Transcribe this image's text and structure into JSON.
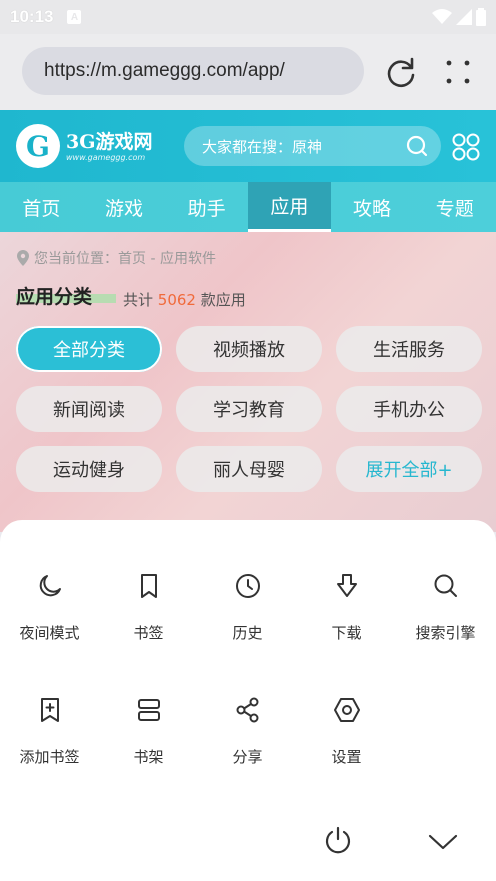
{
  "status": {
    "time": "10:13",
    "badge": "A"
  },
  "browser": {
    "url": "https://m.gameggg.com/app/"
  },
  "site": {
    "logo_text": "3G游戏网",
    "logo_sub": "www.gameggg.com",
    "search_placeholder": "大家都在搜：原神",
    "tabs": [
      "首页",
      "游戏",
      "助手",
      "应用",
      "攻略",
      "专题"
    ],
    "active_tab": "应用"
  },
  "content": {
    "breadcrumb": "您当前位置：首页 - 应用软件",
    "category_title": "应用分类",
    "count_prefix": "共计",
    "count_value": "5062",
    "count_suffix": "款应用",
    "chips": [
      "全部分类",
      "视频播放",
      "生活服务",
      "新闻阅读",
      "学习教育",
      "手机办公",
      "运动健身",
      "丽人母婴",
      "展开全部+"
    ]
  },
  "menu": {
    "items": [
      {
        "label": "夜间模式",
        "icon": "moon-icon"
      },
      {
        "label": "书签",
        "icon": "bookmark-icon"
      },
      {
        "label": "历史",
        "icon": "clock-icon"
      },
      {
        "label": "下载",
        "icon": "download-icon"
      },
      {
        "label": "搜索引擎",
        "icon": "search-icon"
      },
      {
        "label": "添加书签",
        "icon": "add-bookmark-icon"
      },
      {
        "label": "书架",
        "icon": "bookshelf-icon"
      },
      {
        "label": "分享",
        "icon": "share-icon"
      },
      {
        "label": "设置",
        "icon": "settings-icon"
      }
    ]
  },
  "colors": {
    "accent": "#2bbfd6",
    "count": "#f06a3b",
    "header": "#1fb7cf"
  }
}
